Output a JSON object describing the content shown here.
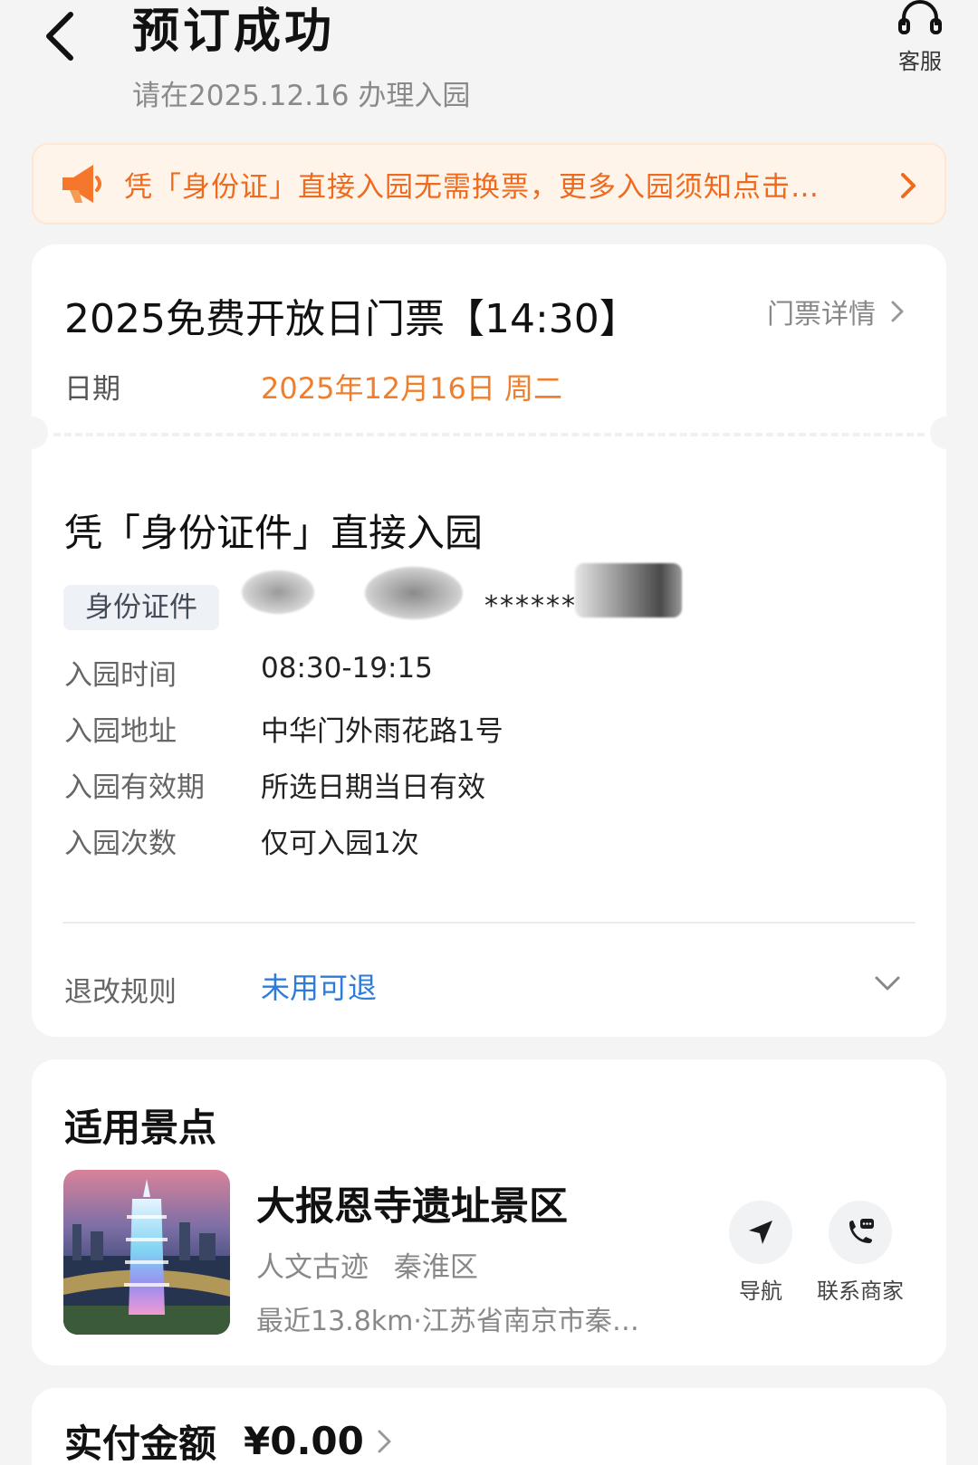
{
  "header": {
    "title": "预订成功",
    "subtitle": "请在2025.12.16 办理入园",
    "customer_service_label": "客服"
  },
  "notice": {
    "text": "凭「身份证」直接入园无需换票，更多入园须知点击…"
  },
  "ticket": {
    "title": "2025免费开放日门票【14:30】",
    "detail_link": "门票详情",
    "date_label": "日期",
    "date_value": "2025年12月16日 周二",
    "entry_title": "凭「身份证件」直接入园",
    "id_tag": "身份证件",
    "id_masked": "********",
    "rows": [
      {
        "label": "入园时间",
        "value": "08:30-19:15"
      },
      {
        "label": "入园地址",
        "value": "中华门外雨花路1号"
      },
      {
        "label": "入园有效期",
        "value": "所选日期当日有效"
      },
      {
        "label": "入园次数",
        "value": "仅可入园1次"
      }
    ],
    "refund_label": "退改规则",
    "refund_value": "未用可退"
  },
  "scenic": {
    "section_title": "适用景点",
    "name": "大报恩寺遗址景区",
    "tags": [
      "人文古迹",
      "秦淮区"
    ],
    "address": "最近13.8km·江苏省南京市秦…",
    "nav_label": "导航",
    "contact_label": "联系商家"
  },
  "payment": {
    "label": "实付金额",
    "value": "¥0.00"
  },
  "colors": {
    "accent_orange": "#f07e2d",
    "notice_text": "#f06a1e",
    "link_blue": "#2f7bd8"
  }
}
